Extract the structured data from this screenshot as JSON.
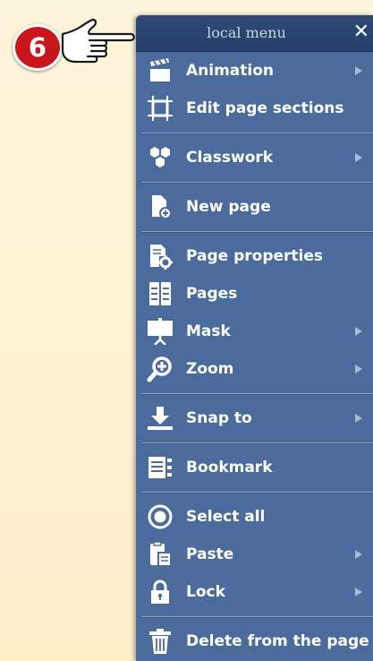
{
  "step_badge": "6",
  "menu": {
    "title": "local menu",
    "close_symbol": "✕",
    "groups": [
      [
        {
          "label": "Animation",
          "icon": "clapperboard-icon",
          "submenu": true
        },
        {
          "label": "Edit page sections",
          "icon": "crop-frame-icon",
          "submenu": false
        }
      ],
      [
        {
          "label": "Classwork",
          "icon": "hexagons-icon",
          "submenu": true
        }
      ],
      [
        {
          "label": "New page",
          "icon": "new-page-icon",
          "submenu": false
        }
      ],
      [
        {
          "label": "Page properties",
          "icon": "page-settings-icon",
          "submenu": false
        },
        {
          "label": "Pages",
          "icon": "pages-grid-icon",
          "submenu": false
        },
        {
          "label": "Mask",
          "icon": "screen-mask-icon",
          "submenu": true
        },
        {
          "label": "Zoom",
          "icon": "zoom-in-icon",
          "submenu": true
        }
      ],
      [
        {
          "label": "Snap to",
          "icon": "download-arrow-icon",
          "submenu": true
        }
      ],
      [
        {
          "label": "Bookmark",
          "icon": "bookmark-list-icon",
          "submenu": false
        }
      ],
      [
        {
          "label": "Select all",
          "icon": "radio-target-icon",
          "submenu": false
        },
        {
          "label": "Paste",
          "icon": "paste-clipboard-icon",
          "submenu": true
        },
        {
          "label": "Lock",
          "icon": "padlock-icon",
          "submenu": true
        }
      ],
      [
        {
          "label": "Delete from the page",
          "icon": "trash-icon",
          "submenu": false
        }
      ]
    ]
  }
}
